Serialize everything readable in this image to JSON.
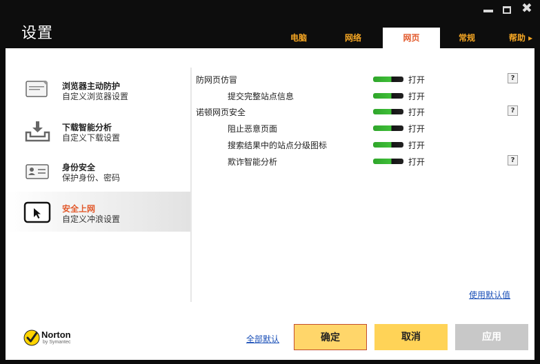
{
  "window": {
    "title": "设置",
    "controls": [
      "minimize-icon",
      "maximize-icon",
      "close-icon"
    ]
  },
  "tabs": [
    {
      "label": "电脑",
      "active": false
    },
    {
      "label": "网络",
      "active": false
    },
    {
      "label": "网页",
      "active": true
    },
    {
      "label": "常规",
      "active": false
    },
    {
      "label": "帮助 ▸",
      "active": false
    }
  ],
  "sidebar": {
    "items": [
      {
        "title": "浏览器主动防护",
        "subtitle": "自定义浏览器设置",
        "icon": "browser-icon",
        "selected": false
      },
      {
        "title": "下载智能分析",
        "subtitle": "自定义下载设置",
        "icon": "download-icon",
        "selected": false
      },
      {
        "title": "身份安全",
        "subtitle": "保护身份、密码",
        "icon": "id-card-icon",
        "selected": false
      },
      {
        "title": "安全上网",
        "subtitle": "自定义冲浪设置",
        "icon": "cursor-window-icon",
        "selected": true
      }
    ]
  },
  "settings": {
    "rows": [
      {
        "label": "防网页仿冒",
        "state": "打开",
        "on": true,
        "help": "?"
      },
      {
        "label": "提交完整站点信息",
        "state": "打开",
        "on": true,
        "help": ""
      },
      {
        "label": "诺顿网页安全",
        "state": "打开",
        "on": true,
        "help": "?"
      },
      {
        "label": "阻止恶意页面",
        "state": "打开",
        "on": true,
        "help": ""
      },
      {
        "label": "搜索结果中的站点分级图标",
        "state": "打开",
        "on": true,
        "help": ""
      },
      {
        "label": "欺诈智能分析",
        "state": "打开",
        "on": true,
        "help": "?"
      }
    ],
    "use_defaults_link": "使用默认值"
  },
  "footer": {
    "logo_brand": "Norton",
    "logo_sub": "by Symantec",
    "all_defaults_link": "全部默认",
    "ok_label": "确定",
    "cancel_label": "取消",
    "apply_label": "应用"
  },
  "colors": {
    "accent": "#f5a623",
    "active_tab_text": "#e2592b",
    "toggle_on": "#3fbf38",
    "link": "#1b50b8"
  }
}
